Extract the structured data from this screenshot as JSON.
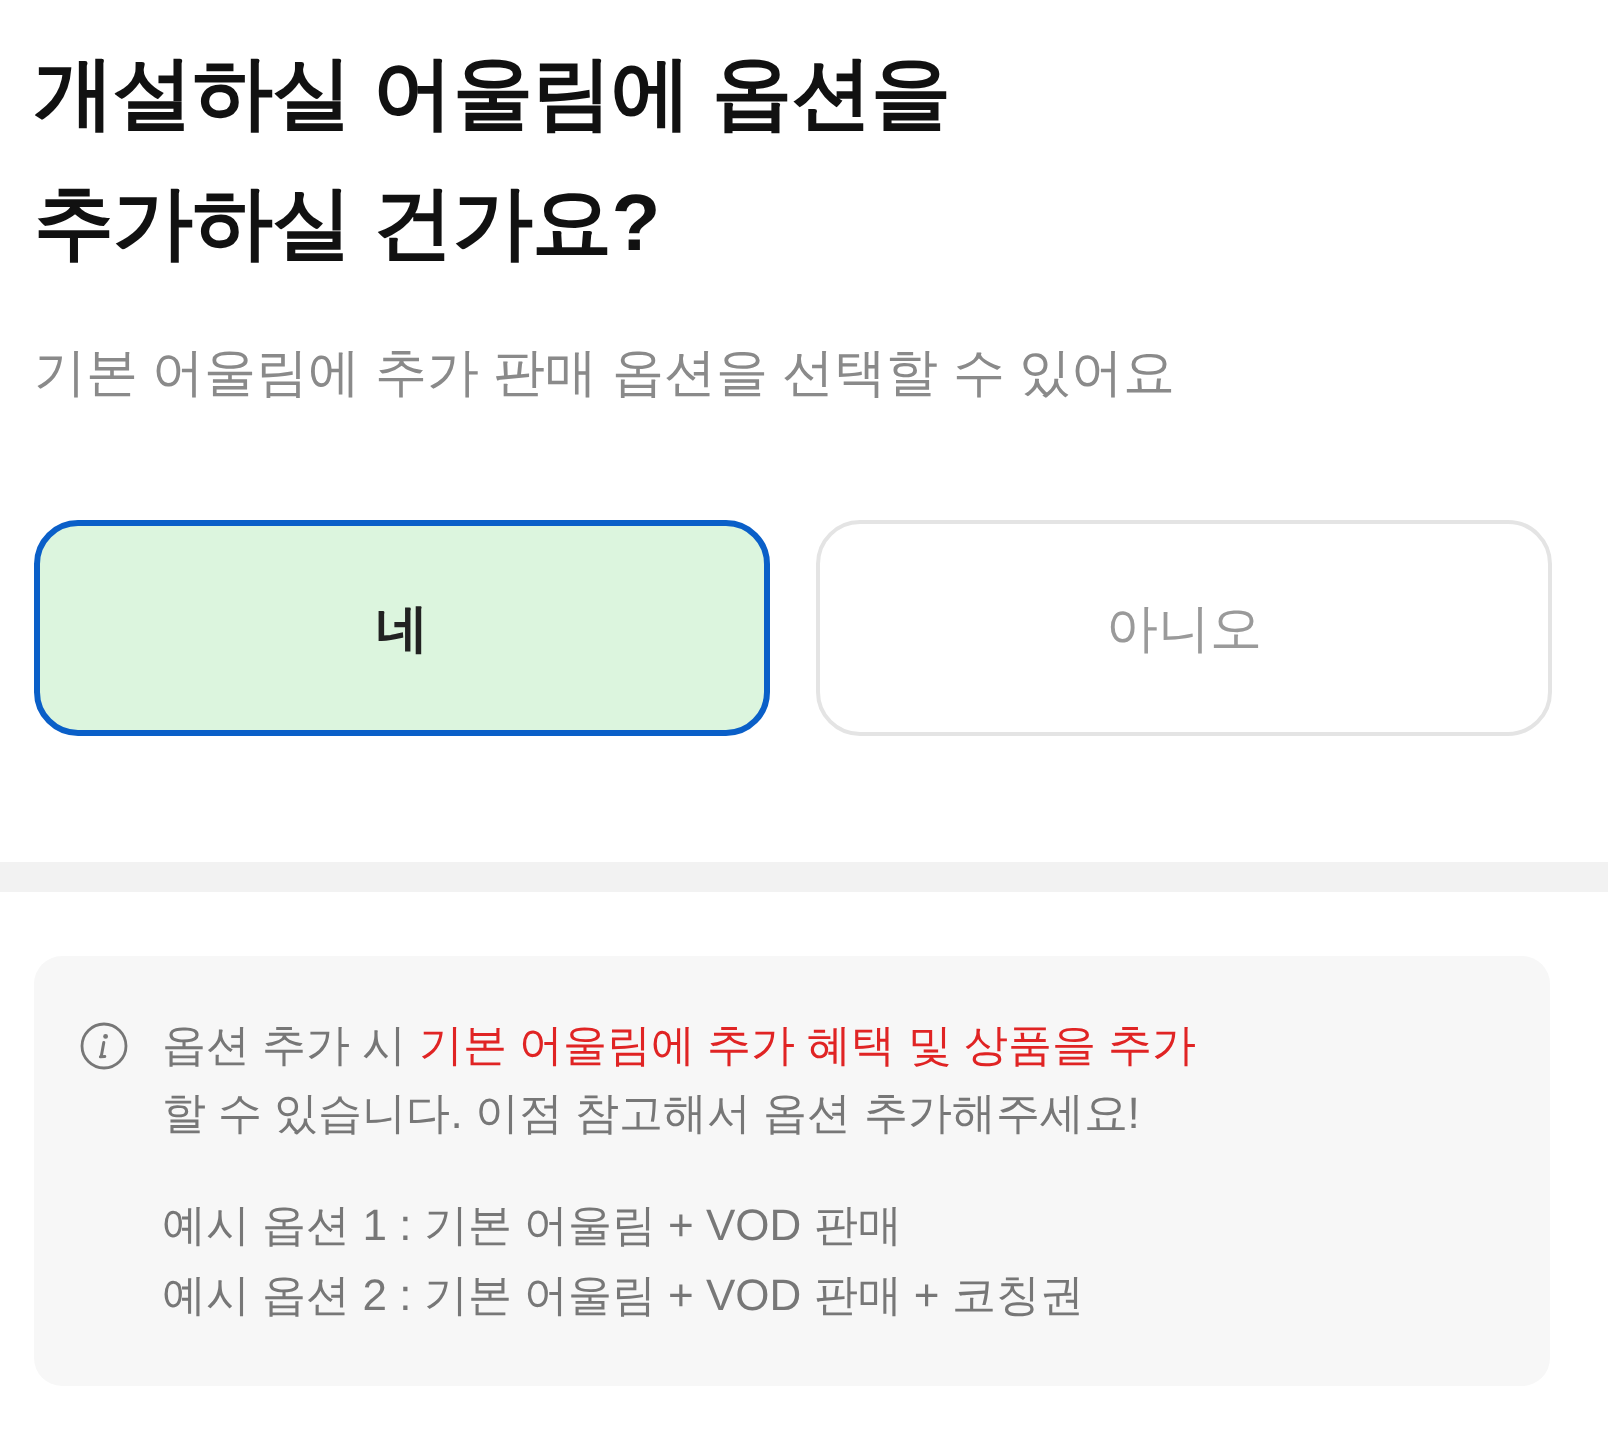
{
  "title_lines": [
    "개설하실 어울림에 옵션을",
    "추가하실 건가요?"
  ],
  "subtitle": "기본 어울림에 추가 판매 옵션을 선택할 수 있어요",
  "choices": [
    {
      "label": "네",
      "selected": true
    },
    {
      "label": "아니오",
      "selected": false
    }
  ],
  "notice": {
    "segments": [
      {
        "text": "옵션 추가 시 ",
        "highlight": false
      },
      {
        "text": "기본 어울림에 추가 혜택 및 상품을 추가",
        "highlight": true
      },
      {
        "text": " 할 수 있습니다. 이점 참고해서 옵션 추가해주세요!",
        "highlight": false
      }
    ],
    "examples": [
      "예시 옵션 1 : 기본 어울림 + VOD 판매",
      "예시 옵션 2 : 기본 어울림 + VOD 판매 + 코칭권"
    ]
  }
}
